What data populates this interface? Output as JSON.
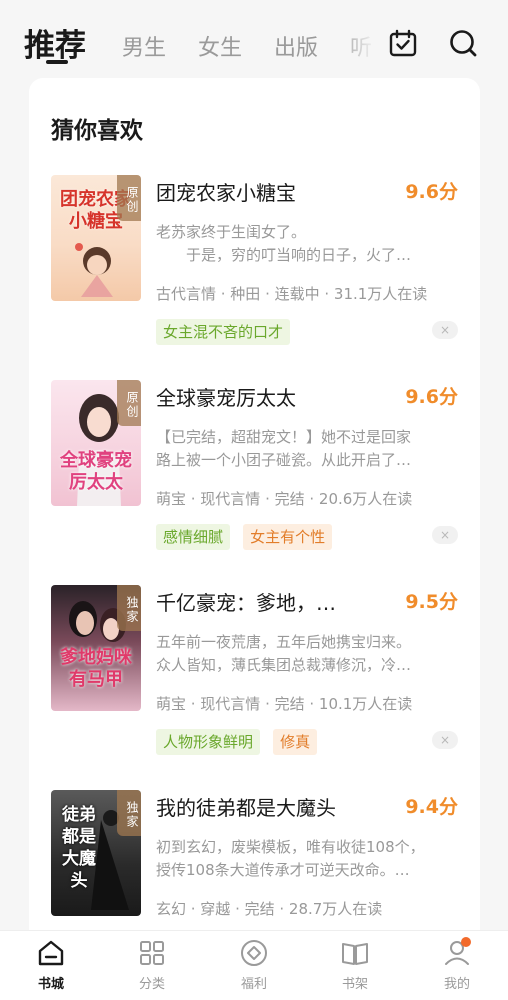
{
  "top_tabs": [
    "推荐",
    "男生",
    "女生",
    "出版",
    "听"
  ],
  "top_icons": [
    "calendar-check-icon",
    "search-icon"
  ],
  "section_title": "猜你喜欢",
  "books": [
    {
      "title": "团宠农家小糖宝",
      "score": "9.6分",
      "badge": "原创",
      "cover_text": "团宠农家小糖宝",
      "desc_lines": [
        "老苏家终于生闺女了。",
        "　　于是，穷的叮当响的日子，火了…"
      ],
      "meta": "古代言情 · 种田 · 连载中 · 31.1万人在读",
      "tags": [
        {
          "text": "女主混不吝的口才",
          "color": "green"
        }
      ]
    },
    {
      "title": "全球豪宠厉太太",
      "score": "9.6分",
      "badge": "原创",
      "cover_text": "全球豪宠厉太太",
      "desc_lines": [
        "【已完结，超甜宠文！】她不过是回家",
        "路上被一个小团子碰瓷。从此开启了…"
      ],
      "meta": "萌宝 · 现代言情 · 完结 · 20.6万人在读",
      "tags": [
        {
          "text": "感情细腻",
          "color": "green"
        },
        {
          "text": "女主有个性",
          "color": "orange"
        }
      ]
    },
    {
      "title": "千亿豪宠：爹地，…",
      "score": "9.5分",
      "badge": "独家",
      "cover_text": "爹地妈咪有马甲",
      "desc_lines": [
        "五年前一夜荒唐，五年后她携宝归来。",
        "众人皆知，薄氏集团总裁薄修沉，冷…"
      ],
      "meta": "萌宝 · 现代言情 · 完结 · 10.1万人在读",
      "tags": [
        {
          "text": "人物形象鲜明",
          "color": "green"
        },
        {
          "text": "修真",
          "color": "orange"
        }
      ]
    },
    {
      "title": "我的徒弟都是大魔头",
      "score": "9.4分",
      "badge": "独家",
      "cover_text": "徒弟都是大魔头",
      "desc_lines": [
        "初到玄幻，废柴模板，唯有收徒108个，",
        "授传108条大道传承才可逆天改命。…"
      ],
      "meta": "玄幻 · 穿越 · 完结 · 28.7万人在读",
      "tags": []
    }
  ],
  "close_symbol": "×",
  "bottom_nav": [
    {
      "label": "书城",
      "icon": "home-icon",
      "active": true
    },
    {
      "label": "分类",
      "icon": "grid-icon",
      "active": false
    },
    {
      "label": "福利",
      "icon": "gift-circle-icon",
      "active": false
    },
    {
      "label": "书架",
      "icon": "book-open-icon",
      "active": false
    },
    {
      "label": "我的",
      "icon": "user-icon",
      "active": false
    }
  ],
  "colors": {
    "accent": "#f08c2b",
    "tag_green": "#6aa82c",
    "tag_orange": "#e27d2a",
    "notification_dot": "#f26a2b"
  }
}
